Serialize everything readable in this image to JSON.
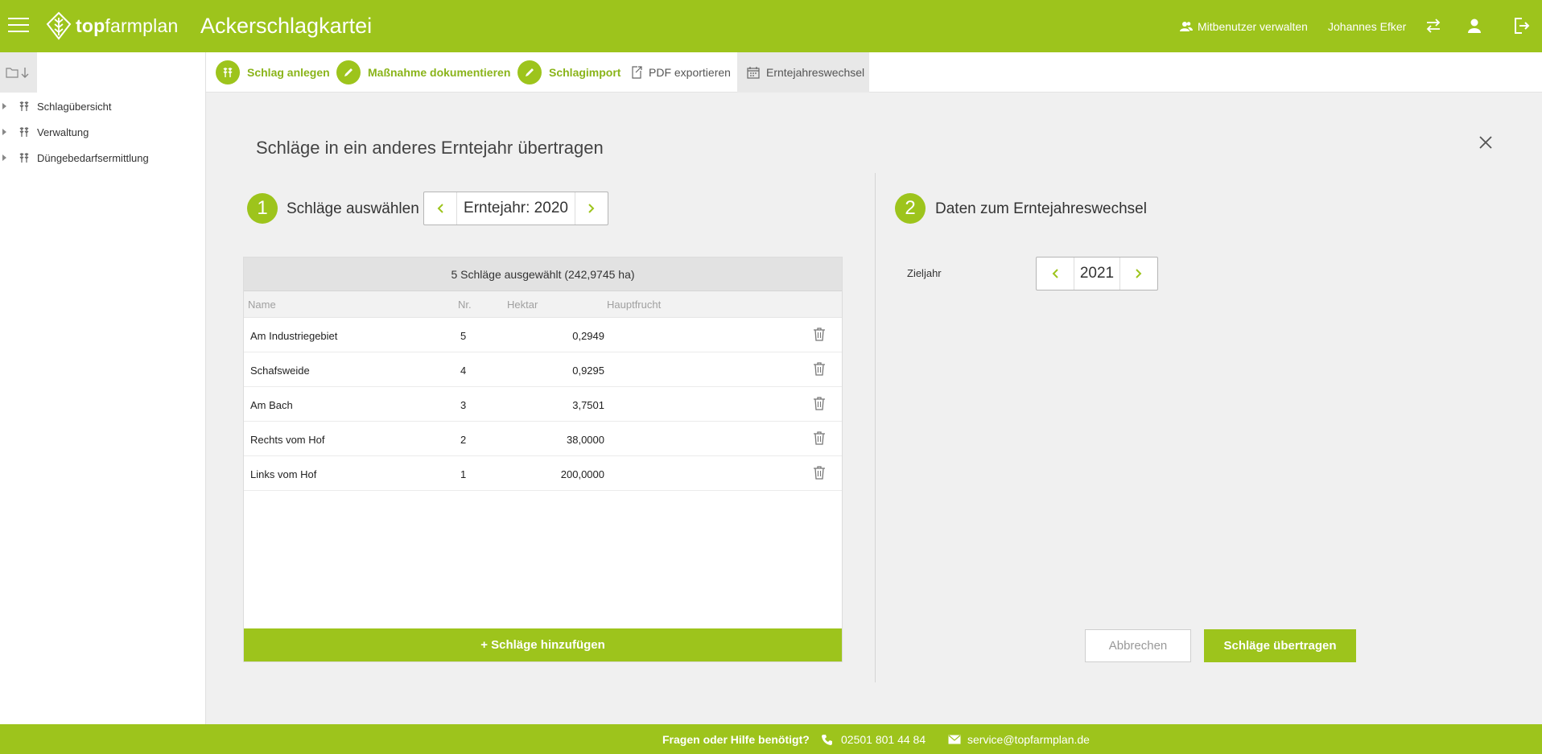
{
  "header": {
    "brand_bold": "top",
    "brand_regular": "farmplan",
    "app_title": "Ackerschlagkartei",
    "co_users_label": "Mitbenutzer verwalten",
    "user_name": "Johannes Efker"
  },
  "sidebar": {
    "items": [
      {
        "label": "Schlagübersicht"
      },
      {
        "label": "Verwaltung"
      },
      {
        "label": "Düngebedarfsermittlung"
      }
    ]
  },
  "toolbar": {
    "add_field": "Schlag anlegen",
    "document_measure": "Maßnahme dokumentieren",
    "field_import": "Schlagimport",
    "pdf_export": "PDF exportieren",
    "harvest_year_change": "Erntejahreswechsel"
  },
  "dialog": {
    "title": "Schläge in ein anderes Erntejahr übertragen",
    "step1": {
      "number": "1",
      "label": "Schläge auswählen",
      "year_value": "Erntejahr: 2020"
    },
    "step2": {
      "number": "2",
      "label": "Daten zum Erntejahreswechsel",
      "target_label": "Zieljahr",
      "target_value": "2021"
    },
    "table": {
      "summary": "5 Schläge ausgewählt (242,9745 ha)",
      "columns": {
        "name": "Name",
        "nr": "Nr.",
        "hektar": "Hektar",
        "hauptfrucht": "Hauptfrucht"
      },
      "rows": [
        {
          "name": "Am Industriegebiet",
          "nr": "5",
          "hektar": "0,2949",
          "hauptfrucht": ""
        },
        {
          "name": "Schafsweide",
          "nr": "4",
          "hektar": "0,9295",
          "hauptfrucht": ""
        },
        {
          "name": "Am Bach",
          "nr": "3",
          "hektar": "3,7501",
          "hauptfrucht": ""
        },
        {
          "name": "Rechts vom Hof",
          "nr": "2",
          "hektar": "38,0000",
          "hauptfrucht": ""
        },
        {
          "name": "Links vom Hof",
          "nr": "1",
          "hektar": "200,0000",
          "hauptfrucht": ""
        }
      ],
      "add_label": "+ Schläge hinzufügen"
    },
    "cancel_label": "Abbrechen",
    "submit_label": "Schläge übertragen"
  },
  "footer": {
    "help_text": "Fragen oder Hilfe benötigt?",
    "phone": "02501 801 44 84",
    "email": "service@topfarmplan.de"
  },
  "colors": {
    "accent": "#9dc41c",
    "background": "#f0f0f0"
  }
}
